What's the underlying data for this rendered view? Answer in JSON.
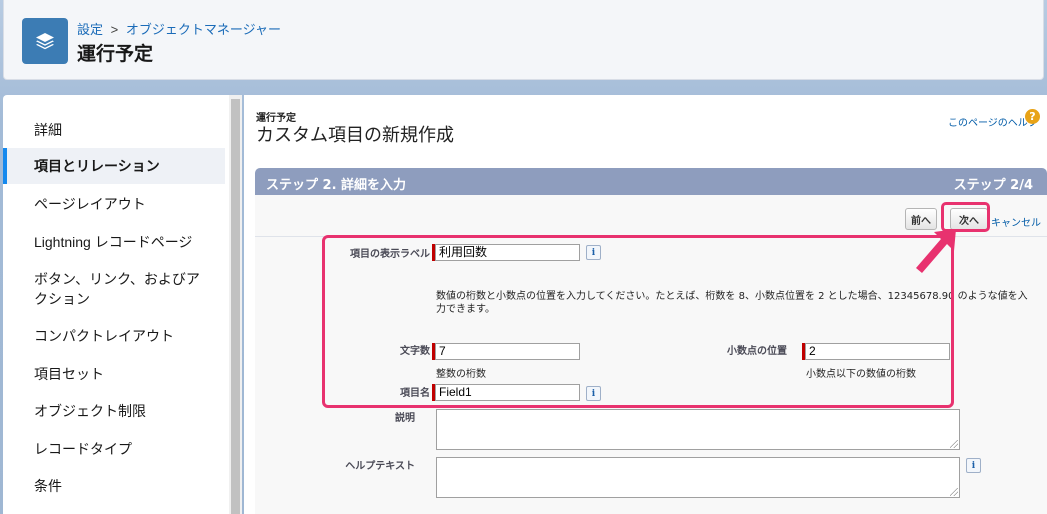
{
  "header": {
    "breadcrumb": [
      "設定",
      "オブジェクトマネージャー"
    ],
    "breadcrumb_sep": ">",
    "object_title": "運行予定",
    "icon": "layers-icon"
  },
  "sidebar": {
    "items": [
      {
        "label": "詳細",
        "active": false
      },
      {
        "label": "項目とリレーション",
        "active": true
      },
      {
        "label": "ページレイアウト",
        "active": false
      },
      {
        "label": "Lightning レコードページ",
        "active": false
      },
      {
        "label": "ボタン、リンク、およびア",
        "active": false
      },
      {
        "label": "クション",
        "active": false
      },
      {
        "label": "コンパクトレイアウト",
        "active": false
      },
      {
        "label": "項目セット",
        "active": false
      },
      {
        "label": "オブジェクト制限",
        "active": false
      },
      {
        "label": "レコードタイプ",
        "active": false
      },
      {
        "label": "条件",
        "active": false
      }
    ]
  },
  "page": {
    "subtitle": "運行予定",
    "title": "カスタム項目の新規作成",
    "help_link": "このページのヘルプ",
    "help_icon": "?"
  },
  "step": {
    "label": "ステップ 2. 詳細を入力",
    "count": "ステップ 2/4"
  },
  "buttons": {
    "prev": "前へ",
    "next": "次へ",
    "cancel": "キャンセル"
  },
  "form": {
    "label_field": {
      "label": "項目の表示ラベル",
      "value": "利用回数"
    },
    "info_glyph": "i",
    "instruction": "数値の桁数と小数点の位置を入力してください。たとえば、桁数を 8、小数点位置を 2 とした場合、12345678.90 のような値を入力できます。",
    "length": {
      "label": "文字数",
      "value": "7",
      "hint": "整数の桁数"
    },
    "decimal": {
      "label": "小数点の位置",
      "value": "2",
      "hint": "小数点以下の数値の桁数"
    },
    "field_name": {
      "label": "項目名",
      "value": "Field1"
    },
    "description": {
      "label": "説明",
      "value": ""
    },
    "help_text": {
      "label": "ヘルプテキスト",
      "value": ""
    }
  },
  "colors": {
    "accent": "#1589ee",
    "step_bar": "#8e9dbe",
    "highlight": "#e8326f",
    "required": "#c00000"
  }
}
